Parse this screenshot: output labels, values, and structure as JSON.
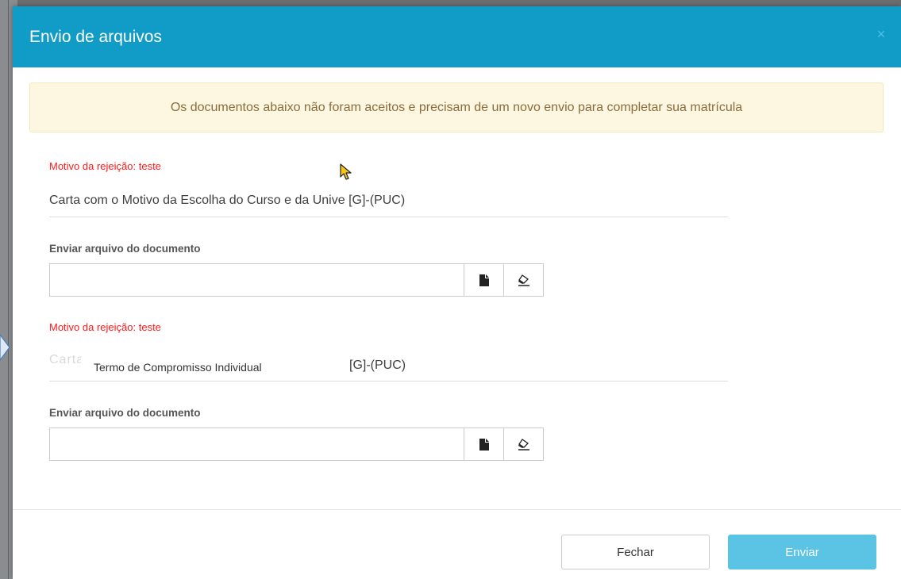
{
  "modal": {
    "title": "Envio de arquivos",
    "close_glyph": "×"
  },
  "alert": {
    "text": "Os documentos abaixo não foram aceitos e precisam de um novo envio para completar sua matrícula",
    "color": "#8a6d3b",
    "background": "#fdf6e1"
  },
  "documents": [
    {
      "rejection": "Motivo da rejeição: teste",
      "name": "Carta com o Motivo da Escolha do Curso e da Unive [G]-(PUC)",
      "upload_label": "Enviar arquivo do documento",
      "input_value": "",
      "file_icon": "file-icon",
      "clear_icon": "eraser-icon"
    },
    {
      "rejection": "Motivo da rejeição: teste",
      "name_overlay": "Termo de Compromisso Individual",
      "name_suffix": "[G]-(PUC)",
      "upload_label": "Enviar arquivo do documento",
      "input_value": "",
      "file_icon": "file-icon",
      "clear_icon": "eraser-icon"
    }
  ],
  "footer": {
    "close_label": "Fechar",
    "send_label": "Enviar"
  },
  "colors": {
    "header": "#119cc7",
    "rejection_text": "#ff1a1a",
    "send_button": "#5bc3e4"
  }
}
